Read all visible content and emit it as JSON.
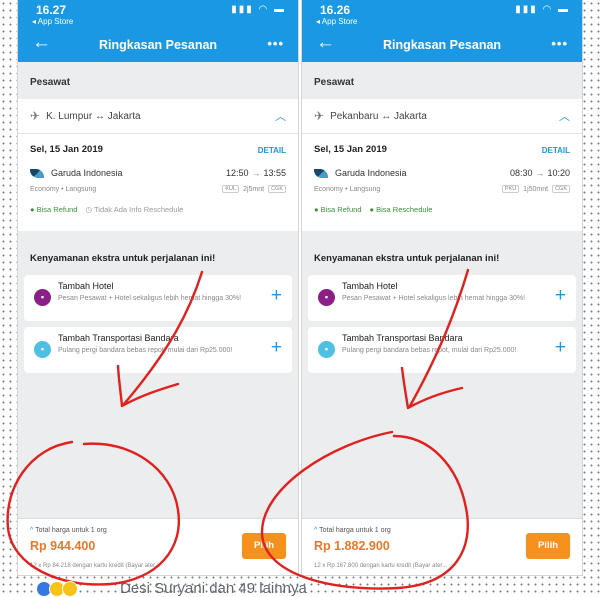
{
  "phones": [
    {
      "status_time": "16.27",
      "back_app": "◂ App Store",
      "title": "Ringkasan Pesanan",
      "section": "Pesawat",
      "route_from": "K. Lumpur",
      "route_to": "Jakarta",
      "date": "Sel, 15 Jan 2019",
      "detail": "DETAIL",
      "airline": "Garuda Indonesia",
      "depart": "12:50",
      "arrive": "13:55",
      "flight_type": "Economy • Langsung",
      "from_code": "KUL",
      "duration": "2j5mnt",
      "to_code": "CGK",
      "refund": "Bisa Refund",
      "reschedule": "Tidak Ada Info Reschedule",
      "reschedule_ok": false,
      "extras_title": "Kenyamanan ekstra untuk perjalanan ini!",
      "hotel_title": "Tambah Hotel",
      "hotel_desc": "Pesan Pesawat + Hotel sekaligus lebih hemat hingga 30%!",
      "transport_title": "Tambah Transportasi Bandara",
      "transport_desc": "Pulang pergi bandara bebas repot, mulai dari Rp25.000!",
      "total_label": "Total harga untuk 1 org",
      "price": "Rp 944.400",
      "pilih": "Pilih",
      "cut_note": "12 x Rp 84.218 dengan kartu kredit (Bayar ater..."
    },
    {
      "status_time": "16.26",
      "back_app": "◂ App Store",
      "title": "Ringkasan Pesanan",
      "section": "Pesawat",
      "route_from": "Pekanbaru",
      "route_to": "Jakarta",
      "date": "Sel, 15 Jan 2019",
      "detail": "DETAIL",
      "airline": "Garuda Indonesia",
      "depart": "08:30",
      "arrive": "10:20",
      "flight_type": "Economy • Langsung",
      "from_code": "PKU",
      "duration": "1j50mnt",
      "to_code": "CGK",
      "refund": "Bisa Refund",
      "reschedule": "Bisa Reschedule",
      "reschedule_ok": true,
      "extras_title": "Kenyamanan ekstra untuk perjalanan ini!",
      "hotel_title": "Tambah Hotel",
      "hotel_desc": "Pesan Pesawat + Hotel sekaligus lebih hemat hingga 30%!",
      "transport_title": "Tambah Transportasi Bandara",
      "transport_desc": "Pulang pergi bandara bebas repot, mulai dari Rp25.000!",
      "total_label": "Total harga untuk 1 org",
      "price": "Rp 1.882.900",
      "pilih": "Pilih",
      "cut_note": "12 x Rp 167.800 dengan kartu kredit (Bayar ater..."
    }
  ],
  "footer": {
    "liker": "Desi Suryani dan 49 lainnya"
  },
  "colors": {
    "primary": "#1a98e3",
    "price": "#e8792b",
    "button": "#f7911d",
    "annotation": "#e0211e"
  },
  "icons": [
    "plane-icon",
    "round-trip-icon",
    "hotel-icon",
    "transport-icon",
    "plus-icon",
    "back-arrow-icon",
    "more-icon"
  ]
}
